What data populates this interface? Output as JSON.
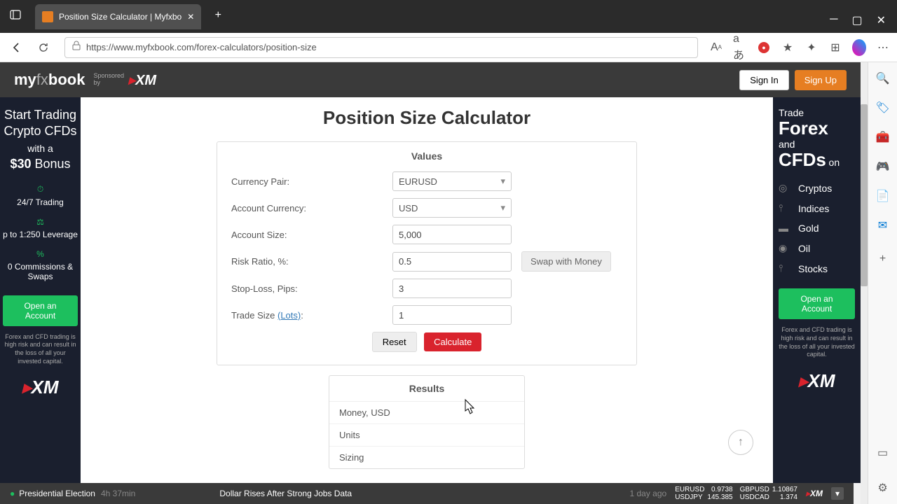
{
  "browser": {
    "tab_title": "Position Size Calculator | Myfxbo",
    "url": "https://www.myfxbook.com/forex-calculators/position-size"
  },
  "header": {
    "logo_my": "my",
    "logo_fx": "fx",
    "logo_book": "book",
    "sponsored": "Sponsored",
    "by": "by",
    "xm": "XM",
    "signin": "Sign In",
    "signup": "Sign Up"
  },
  "page": {
    "title": "Position Size Calculator",
    "values_title": "Values",
    "results_title": "Results"
  },
  "form": {
    "currency_pair_label": "Currency Pair:",
    "currency_pair_value": "EURUSD",
    "account_currency_label": "Account Currency:",
    "account_currency_value": "USD",
    "account_size_label": "Account Size:",
    "account_size_value": "5,000",
    "risk_ratio_label": "Risk Ratio, %:",
    "risk_ratio_value": "0.5",
    "swap_label": "Swap with Money",
    "stop_loss_label": "Stop-Loss, Pips:",
    "stop_loss_value": "3",
    "trade_size_label": "Trade Size ",
    "lots_link": "(Lots)",
    "trade_size_value": "1",
    "reset": "Reset",
    "calculate": "Calculate"
  },
  "results": {
    "money": "Money, USD",
    "units": "Units",
    "sizing": "Sizing"
  },
  "ad_left": {
    "line1": "Start Trading",
    "line2": "Crypto CFDs",
    "line3": "with a",
    "bonus": "$30",
    "bonus2": "Bonus",
    "feat1": "24/7 Trading",
    "feat2": "p to 1:250 Leverage",
    "feat3": "0 Commissions & Swaps",
    "open": "Open an Account",
    "disclaimer": "Forex and CFD trading is high risk and can result in the loss of all your invested capital."
  },
  "ad_right": {
    "trade": "Trade",
    "forex": "Forex",
    "and": "and",
    "cfds": "CFDs",
    "on": "on",
    "assets": [
      "Cryptos",
      "Indices",
      "Gold",
      "Oil",
      "Stocks"
    ],
    "open": "Open an Account",
    "disclaimer": "Forex and CFD trading is high risk and can result in the loss of all your invested capital."
  },
  "ticker": {
    "news1": "Presidential Election",
    "time1": "4h 37min",
    "news2": "Dollar Rises After Strong Jobs Data",
    "time2": "1 day ago",
    "pairs": [
      {
        "sym": "EURUSD",
        "val": "0.9738"
      },
      {
        "sym": "USDJPY",
        "val": "145.385"
      },
      {
        "sym": "GBPUSD",
        "val": "1.10867"
      },
      {
        "sym": "USDCAD",
        "val": "1.374"
      }
    ]
  }
}
